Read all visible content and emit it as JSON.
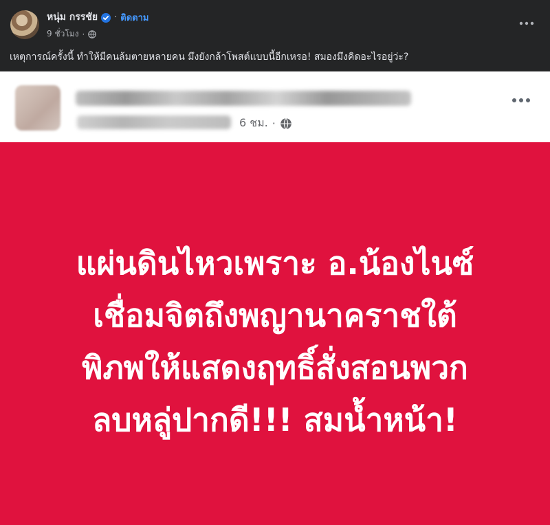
{
  "post": {
    "author_name": "หนุ่ม กรรชัย",
    "follow_label": "ติดตาม",
    "time": "9 ชั่วโมง",
    "text": "เหตุการณ์ครั้งนี้ ทำให้มีคนล้มตายหลายคน มึงยังกล้าโพสต์แบบนี้อีกเหรอ! สมองมึงคิดอะไรอยู่ว่ะ?",
    "more_icon": "more-horizontal-icon",
    "verified_icon": "verified-badge-icon",
    "privacy_icon": "globe-icon"
  },
  "shared_post": {
    "time": "6 ชม.",
    "privacy_icon": "globe-icon",
    "more_icon": "more-horizontal-icon",
    "image_text": [
      "แผ่นดินไหวเพราะ อ.น้องไนซ์",
      "เชื่อมจิตถึงพญานาคราชใต้",
      "พิภพให้แสดงฤทธิ์สั่งสอนพวก",
      "ลบหลู่ปากดี!!! สมน้ำหน้า!"
    ]
  },
  "colors": {
    "dark_bg": "#242526",
    "text_primary": "#e4e6eb",
    "text_secondary": "#b0b3b8",
    "link_blue": "#4599ff",
    "panel_red": "#e0123e",
    "white": "#ffffff"
  }
}
